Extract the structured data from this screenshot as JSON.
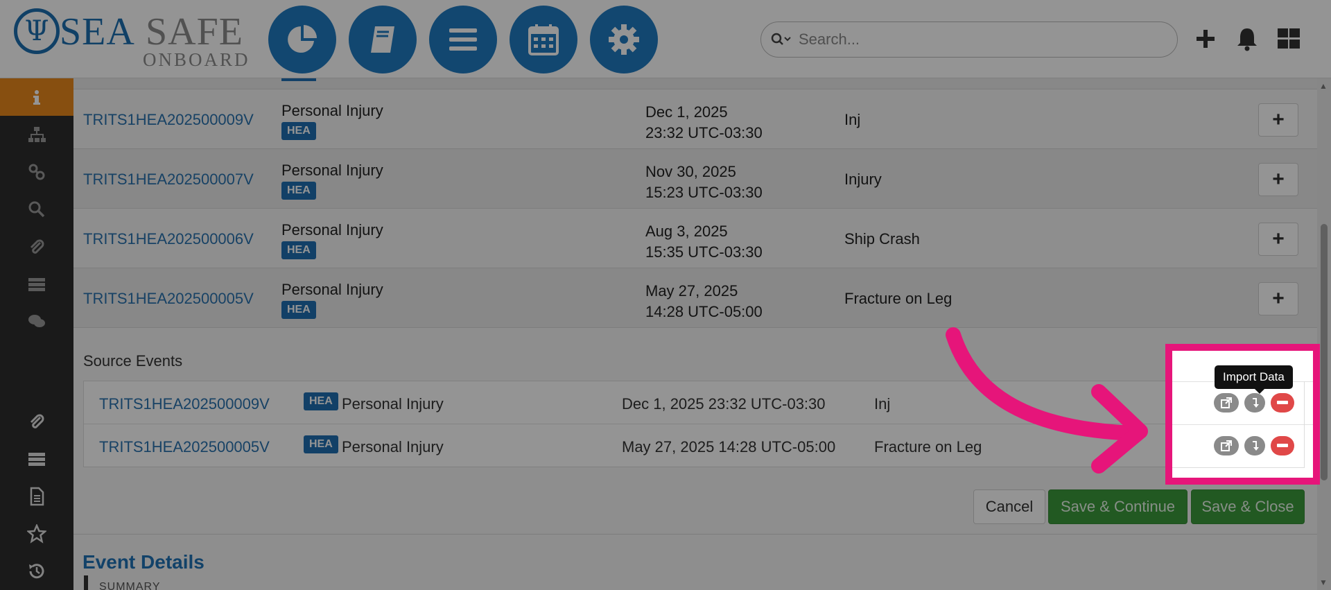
{
  "header": {
    "logo": {
      "sea": "SEA",
      "safe": "SAFE",
      "onboard": "ONBOARD"
    },
    "nav_icons": [
      "chart-pie-icon",
      "book-icon",
      "bars-icon",
      "calendar-icon",
      "gear-icon"
    ],
    "search": {
      "placeholder": "Search..."
    },
    "right_icons": [
      "plus-icon",
      "bell-icon",
      "grid-icon"
    ]
  },
  "sidebar": {
    "items": [
      "info-icon",
      "sitemap-icon",
      "link-icon",
      "search-icon",
      "paperclip-icon",
      "list-icon",
      "comments-icon",
      "paperclip-icon",
      "list-icon",
      "document-icon",
      "star-icon",
      "history-icon"
    ],
    "active_index": 0
  },
  "events": [
    {
      "id": "TRITS1HEA202500009V",
      "type": "Personal Injury",
      "badge": "HEA",
      "date": "Dec 1, 2025",
      "time": "23:32 UTC-03:30",
      "desc": "Inj"
    },
    {
      "id": "TRITS1HEA202500007V",
      "type": "Personal Injury",
      "badge": "HEA",
      "date": "Nov 30, 2025",
      "time": "15:23 UTC-03:30",
      "desc": "Injury"
    },
    {
      "id": "TRITS1HEA202500006V",
      "type": "Personal Injury",
      "badge": "HEA",
      "date": "Aug 3, 2025",
      "time": "15:35 UTC-03:30",
      "desc": "Ship Crash"
    },
    {
      "id": "TRITS1HEA202500005V",
      "type": "Personal Injury",
      "badge": "HEA",
      "date": "May 27, 2025",
      "time": "14:28 UTC-05:00",
      "desc": "Fracture on Leg"
    }
  ],
  "source_events": {
    "title": "Source Events",
    "rows": [
      {
        "id": "TRITS1HEA202500009V",
        "badge": "HEA",
        "type": "Personal Injury",
        "datetime": "Dec 1, 2025 23:32 UTC-03:30",
        "desc": "Inj"
      },
      {
        "id": "TRITS1HEA202500005V",
        "badge": "HEA",
        "type": "Personal Injury",
        "datetime": "May 27, 2025 14:28 UTC-05:00",
        "desc": "Fracture on Leg"
      }
    ],
    "tooltip": "Import Data"
  },
  "actions": {
    "cancel": "Cancel",
    "save_continue": "Save & Continue",
    "save_close": "Save & Close"
  },
  "details": {
    "title": "Event Details",
    "summary_label": "SUMMARY"
  },
  "colors": {
    "accent": "#1f7ac1",
    "highlight": "#e6157a",
    "active": "#e8891d",
    "success": "#3c9a3c",
    "danger": "#e04848"
  }
}
